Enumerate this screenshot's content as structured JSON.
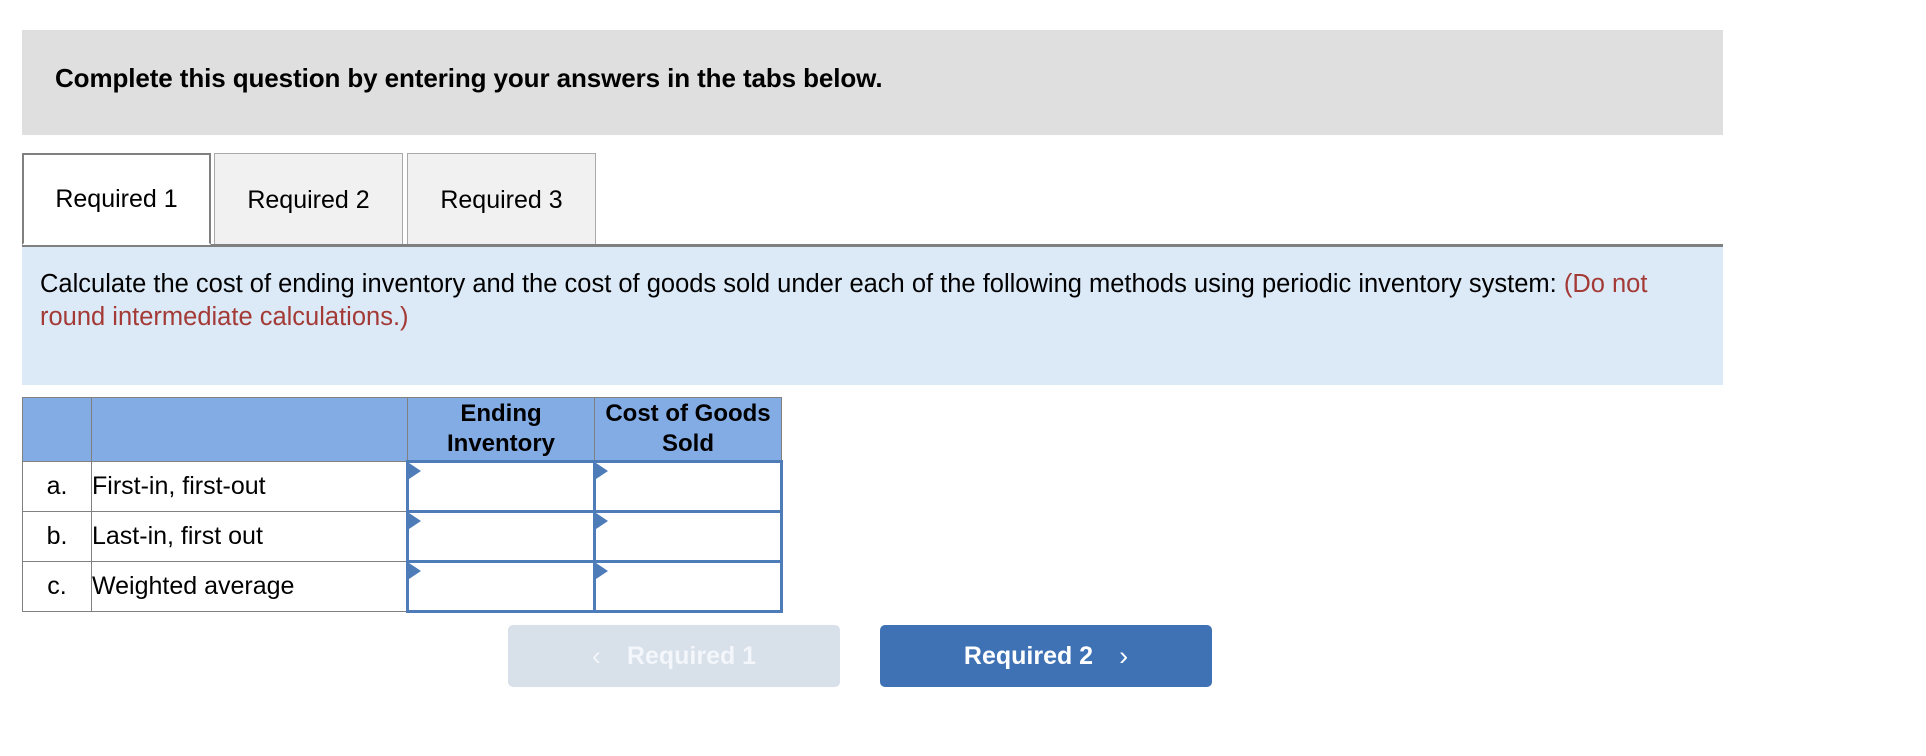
{
  "header": {
    "title": "Complete this question by entering your answers in the tabs below."
  },
  "tabs": {
    "items": [
      {
        "label": "Required 1",
        "active": true
      },
      {
        "label": "Required 2",
        "active": false
      },
      {
        "label": "Required 3",
        "active": false
      }
    ]
  },
  "instruction": {
    "main": "Calculate the cost of ending inventory and the cost of goods sold under each of the following methods using periodic inventory system:",
    "note": "(Do not round intermediate calculations.)"
  },
  "table": {
    "headers": {
      "letter": "",
      "method": "",
      "ending_inventory": "Ending Inventory",
      "cost_of_goods_sold": "Cost of Goods Sold"
    },
    "rows": [
      {
        "letter": "a.",
        "method": "First-in, first-out",
        "ending_inventory": "",
        "cost_of_goods_sold": ""
      },
      {
        "letter": "b.",
        "method": "Last-in, first out",
        "ending_inventory": "",
        "cost_of_goods_sold": ""
      },
      {
        "letter": "c.",
        "method": "Weighted average",
        "ending_inventory": "",
        "cost_of_goods_sold": ""
      }
    ]
  },
  "nav": {
    "prev_label": "Required 1",
    "prev_icon": "chevron-left-icon",
    "prev_glyph": "‹",
    "next_label": "Required 2",
    "next_icon": "chevron-right-icon",
    "next_glyph": "›"
  },
  "colors": {
    "header_bg": "#dfdfdf",
    "banner_bg": "#dce9f7",
    "note_red": "#a33a36",
    "table_header_blue": "#83ace5",
    "input_border_blue": "#4d7cb8",
    "primary_button": "#3e72b5",
    "disabled_button": "#d8e0ea",
    "border_gray": "#808080"
  }
}
